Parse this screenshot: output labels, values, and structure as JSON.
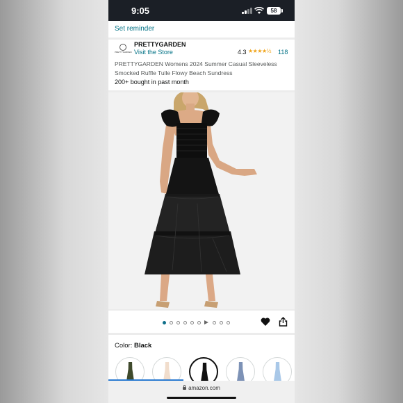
{
  "status_bar": {
    "time": "9:05",
    "battery": "58"
  },
  "reminder": {
    "label": "Set reminder"
  },
  "store": {
    "logo_text": "PRETTYGARDEN",
    "brand": "PRETTYGARDEN",
    "visit_label": "Visit the Store",
    "rating": "4.3",
    "stars": "★★★★½",
    "review_count": "118"
  },
  "product": {
    "title": "PRETTYGARDEN Womens 2024 Summer Casual Sleeveless Smocked Ruffle Tulle Flowy Beach Sundress",
    "bought": "200+ bought in past month"
  },
  "gallery": {
    "active_index": 0,
    "dot_count": 10,
    "video_index": 6
  },
  "color_picker": {
    "label": "Color:",
    "selected": "Black",
    "swatch_colors": [
      "#3f4a2c",
      "#f1ddcc",
      "#111111",
      "#7d92b6",
      "#a9c8e8"
    ]
  },
  "browser": {
    "url": "amazon.com"
  },
  "colors": {
    "link": "#007185",
    "star": "#f0a41b",
    "accent": "#0f6f8a"
  }
}
